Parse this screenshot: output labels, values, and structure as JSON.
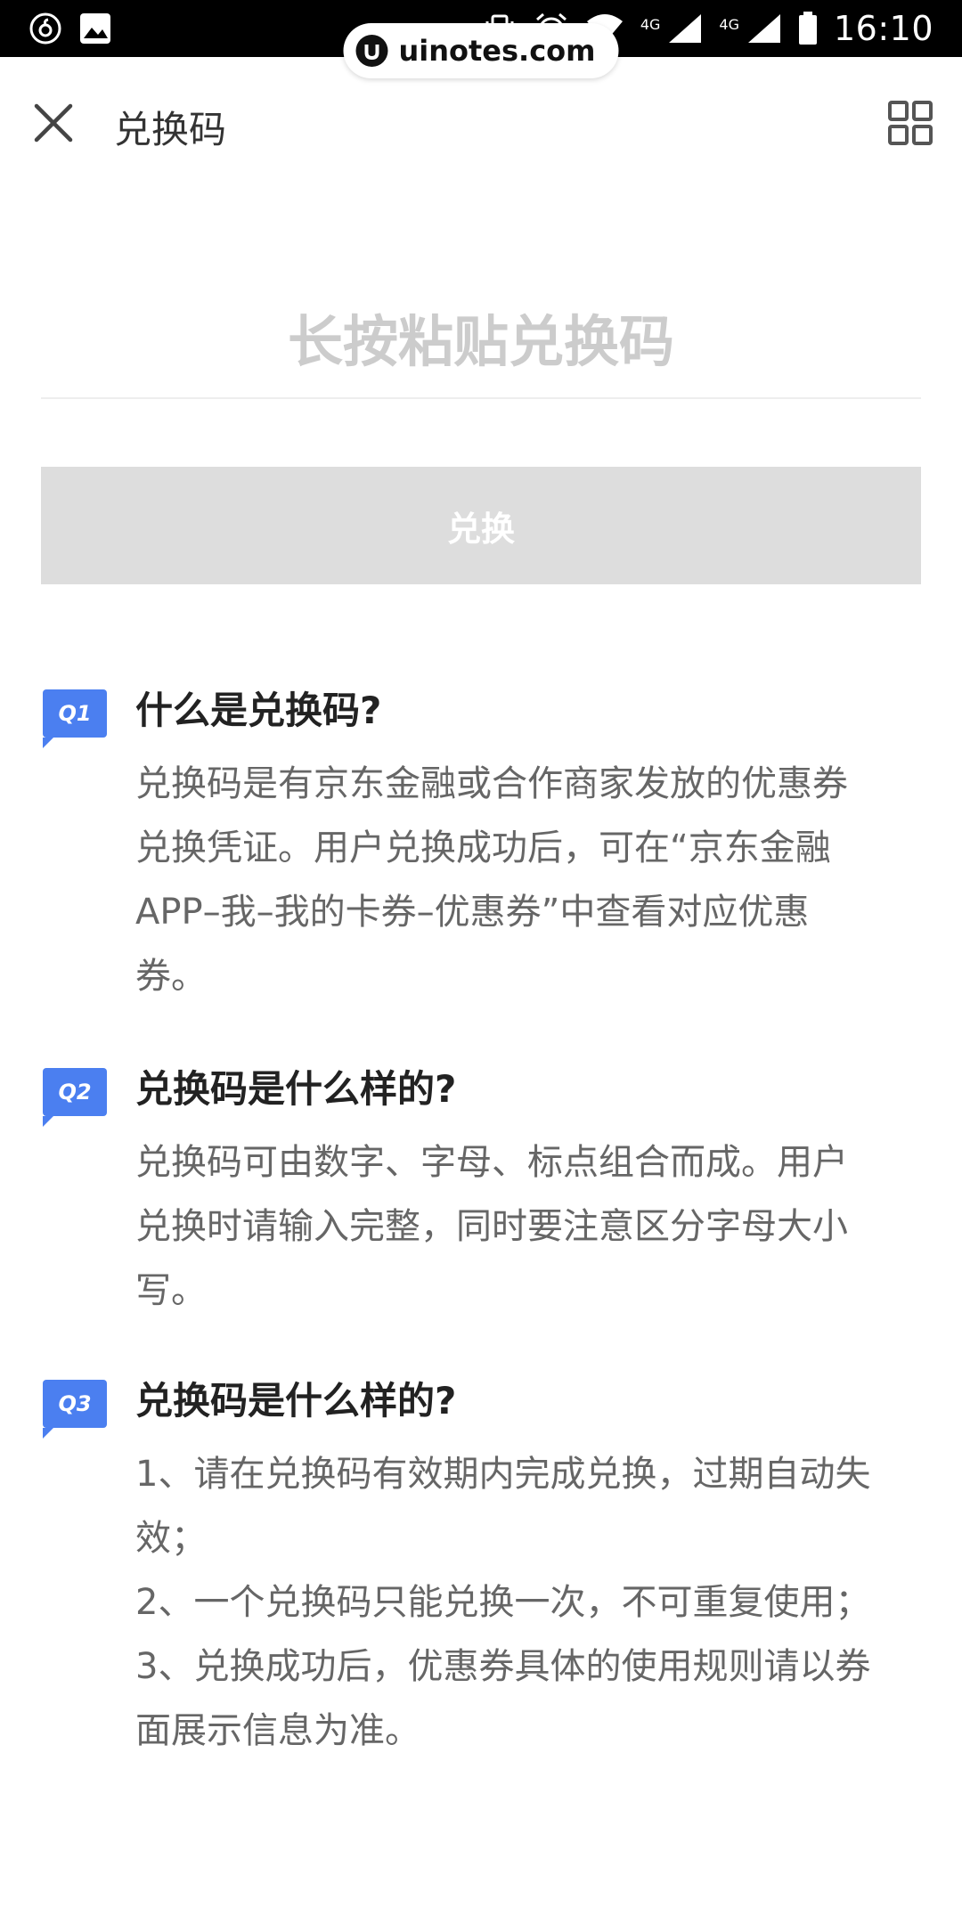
{
  "status_bar": {
    "time": "16:10",
    "network_1": "4G",
    "network_2": "4G",
    "icons": [
      "netease-music-icon",
      "gallery-icon",
      "vibrate-icon",
      "alarm-icon",
      "wifi-icon",
      "signal-icon",
      "battery-icon"
    ]
  },
  "watermark": {
    "text": "uinotes.com"
  },
  "header": {
    "title": "兑换码",
    "close_icon": "close-icon",
    "grid_icon": "grid-icon"
  },
  "redeem": {
    "input_placeholder": "长按粘贴兑换码",
    "input_value": "",
    "button_label": "兑换"
  },
  "faq": [
    {
      "badge": "Q1",
      "question": "什么是兑换码?",
      "answer_lines": [
        "兑换码是有京东金融或合作商家发放的优惠券",
        "兑换凭证。用户兑换成功后，可在“京东金融",
        "APP–我–我的卡券–优惠券”中查看对应优惠",
        "券。"
      ]
    },
    {
      "badge": "Q2",
      "question": "兑换码是什么样的?",
      "answer_lines": [
        "兑换码可由数字、字母、标点组合而成。用户",
        "兑换时请输入完整，同时要注意区分字母大小",
        "写。"
      ]
    },
    {
      "badge": "Q3",
      "question": "兑换码是什么样的?",
      "answer_lines": [
        "1、请在兑换码有效期内完成兑换，过期自动失",
        "效；",
        "2、一个兑换码只能兑换一次，不可重复使用；",
        "3、兑换成功后，优惠券具体的使用规则请以券",
        "面展示信息为准。"
      ]
    }
  ],
  "colors": {
    "badge": "#4b7ff0",
    "button_disabled": "#dddddd",
    "placeholder": "#cccccc",
    "answer_text": "#666666"
  }
}
